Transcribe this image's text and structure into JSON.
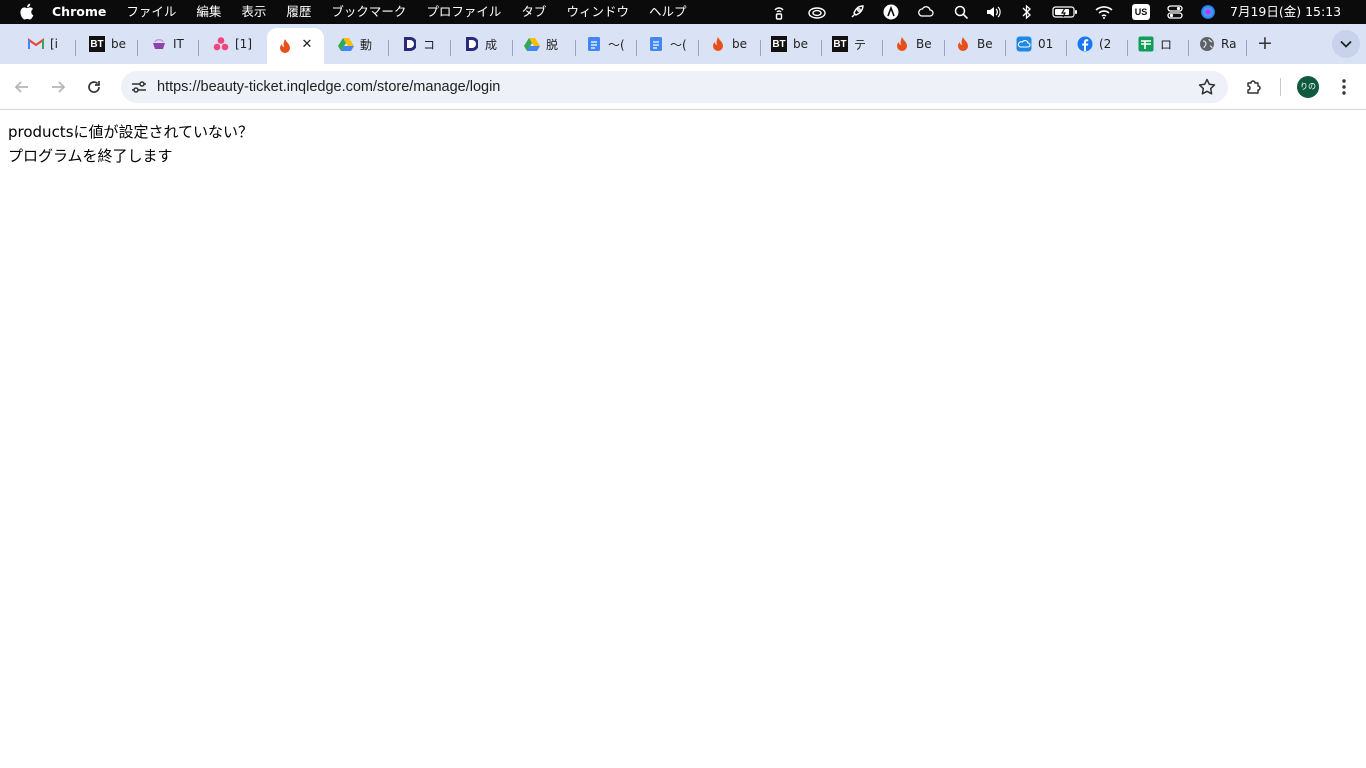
{
  "menubar": {
    "app_name": "Chrome",
    "menus": [
      "ファイル",
      "編集",
      "表示",
      "履歴",
      "ブックマーク",
      "プロファイル",
      "タブ",
      "ウィンドウ",
      "ヘルプ"
    ],
    "status_icons": [
      "wireless-icon",
      "creative-cloud-icon",
      "rocket-icon",
      "astro-icon",
      "cloud-icon",
      "search-icon",
      "volume-icon",
      "bluetooth-icon",
      "battery-icon",
      "wifi-icon",
      "input-source-icon",
      "control-center-icon",
      "siri-icon"
    ],
    "input_source": "US",
    "clock": "7月19日(金) 15:13"
  },
  "tabs": [
    {
      "icon": "gmail-icon",
      "title": "[i"
    },
    {
      "icon": "bt-icon",
      "badge": "BT",
      "title": "be"
    },
    {
      "icon": "cup-icon",
      "title": "IT"
    },
    {
      "icon": "asana-icon",
      "title": "[1]"
    },
    {
      "icon": "fire-icon",
      "title": "",
      "active": true
    },
    {
      "icon": "drive-icon",
      "title": "動"
    },
    {
      "icon": "bracket-icon",
      "title": "コ"
    },
    {
      "icon": "bracket-icon",
      "title": "成"
    },
    {
      "icon": "drive-icon",
      "title": "脱"
    },
    {
      "icon": "docs-icon",
      "title": "〜("
    },
    {
      "icon": "docs-icon",
      "title": "〜("
    },
    {
      "icon": "fire-icon",
      "title": "be"
    },
    {
      "icon": "bt-icon",
      "badge": "BT",
      "title": "be"
    },
    {
      "icon": "bt-icon",
      "badge": "BT",
      "title": "テ"
    },
    {
      "icon": "fire-icon",
      "title": "Be"
    },
    {
      "icon": "fire-icon",
      "title": "Be"
    },
    {
      "icon": "cloud-app-icon",
      "title": "01"
    },
    {
      "icon": "facebook-icon",
      "title": "(2"
    },
    {
      "icon": "sheets-icon",
      "title": "ロ"
    },
    {
      "icon": "globe-icon",
      "title": "Ra"
    }
  ],
  "toolbar": {
    "url": "https://beauty-ticket.inqledge.com/store/manage/login",
    "profile_initials": "りの"
  },
  "page": {
    "lines": [
      "productsに値が設定されていない？",
      "プログラムを終了します"
    ]
  },
  "colors": {
    "menubar_bg": "#0b0b0b",
    "tabstrip_bg": "#dae2f5",
    "omnibox_bg": "#eef1f8",
    "profile_bg": "#0f5a3f"
  }
}
